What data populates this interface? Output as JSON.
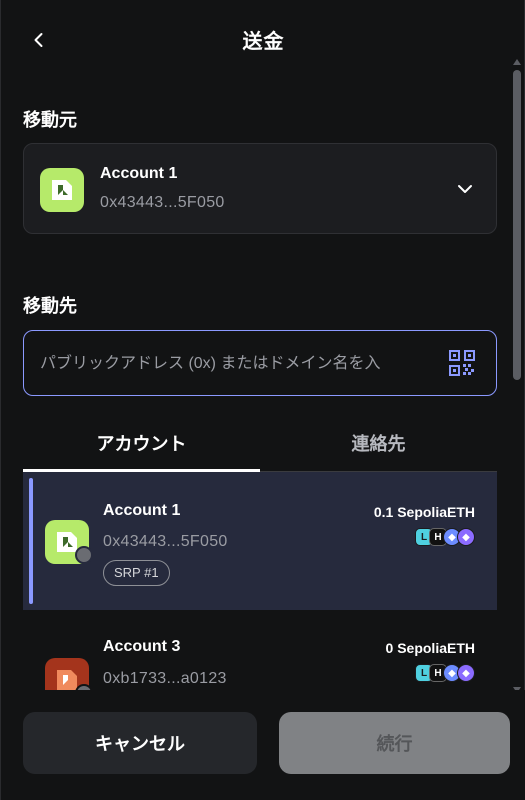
{
  "header": {
    "title": "送金"
  },
  "from": {
    "label": "移動元",
    "account": {
      "name": "Account 1",
      "address": "0x43443...5F050"
    }
  },
  "to": {
    "label": "移動先",
    "placeholder": "パブリックアドレス (0x) またはドメイン名を入"
  },
  "tabs": [
    {
      "label": "アカウント",
      "active": true
    },
    {
      "label": "連絡先",
      "active": false
    }
  ],
  "accounts": [
    {
      "name": "Account 1",
      "address": "0x43443...5F050",
      "badge": "SRP #1",
      "balance": "0.1 SepoliaETH",
      "selected": true
    },
    {
      "name": "Account 3",
      "address": "0xb1733...a0123",
      "balance": "0 SepoliaETH",
      "selected": false
    }
  ],
  "footer": {
    "cancel_label": "キャンセル",
    "continue_label": "続行"
  },
  "colors": {
    "accent": "#8b99ff",
    "avatar_green": "#b6ea6a",
    "avatar_red": "#a4341c",
    "background": "#121314"
  }
}
